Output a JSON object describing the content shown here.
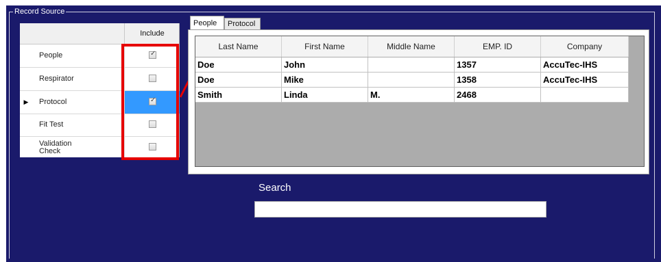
{
  "group": {
    "title": "Record Source"
  },
  "source_grid": {
    "include_header": "Include",
    "rows": [
      {
        "name": "People",
        "checked": true,
        "current": false
      },
      {
        "name": "Respirator",
        "checked": false,
        "current": false
      },
      {
        "name": "Protocol",
        "checked": true,
        "current": true
      },
      {
        "name": "Fit Test",
        "checked": false,
        "current": false
      },
      {
        "name": "Validation Check",
        "checked": false,
        "current": false
      }
    ],
    "current_row_marker": "▶"
  },
  "tabs": [
    {
      "label": "People",
      "active": true
    },
    {
      "label": "Protocol",
      "active": false
    }
  ],
  "people_grid": {
    "columns": [
      "Last Name",
      "First Name",
      "Middle Name",
      "EMP. ID",
      "Company"
    ],
    "rows": [
      [
        "Doe",
        "John",
        "",
        "1357",
        "AccuTec-IHS"
      ],
      [
        "Doe",
        "Mike",
        "",
        "1358",
        "AccuTec-IHS"
      ],
      [
        "Smith",
        "Linda",
        "M.",
        "2468",
        ""
      ]
    ]
  },
  "search": {
    "label": "Search",
    "value": ""
  },
  "colors": {
    "panel": "#1a1a6b",
    "highlight": "#e60000",
    "selection": "#3399ff"
  }
}
